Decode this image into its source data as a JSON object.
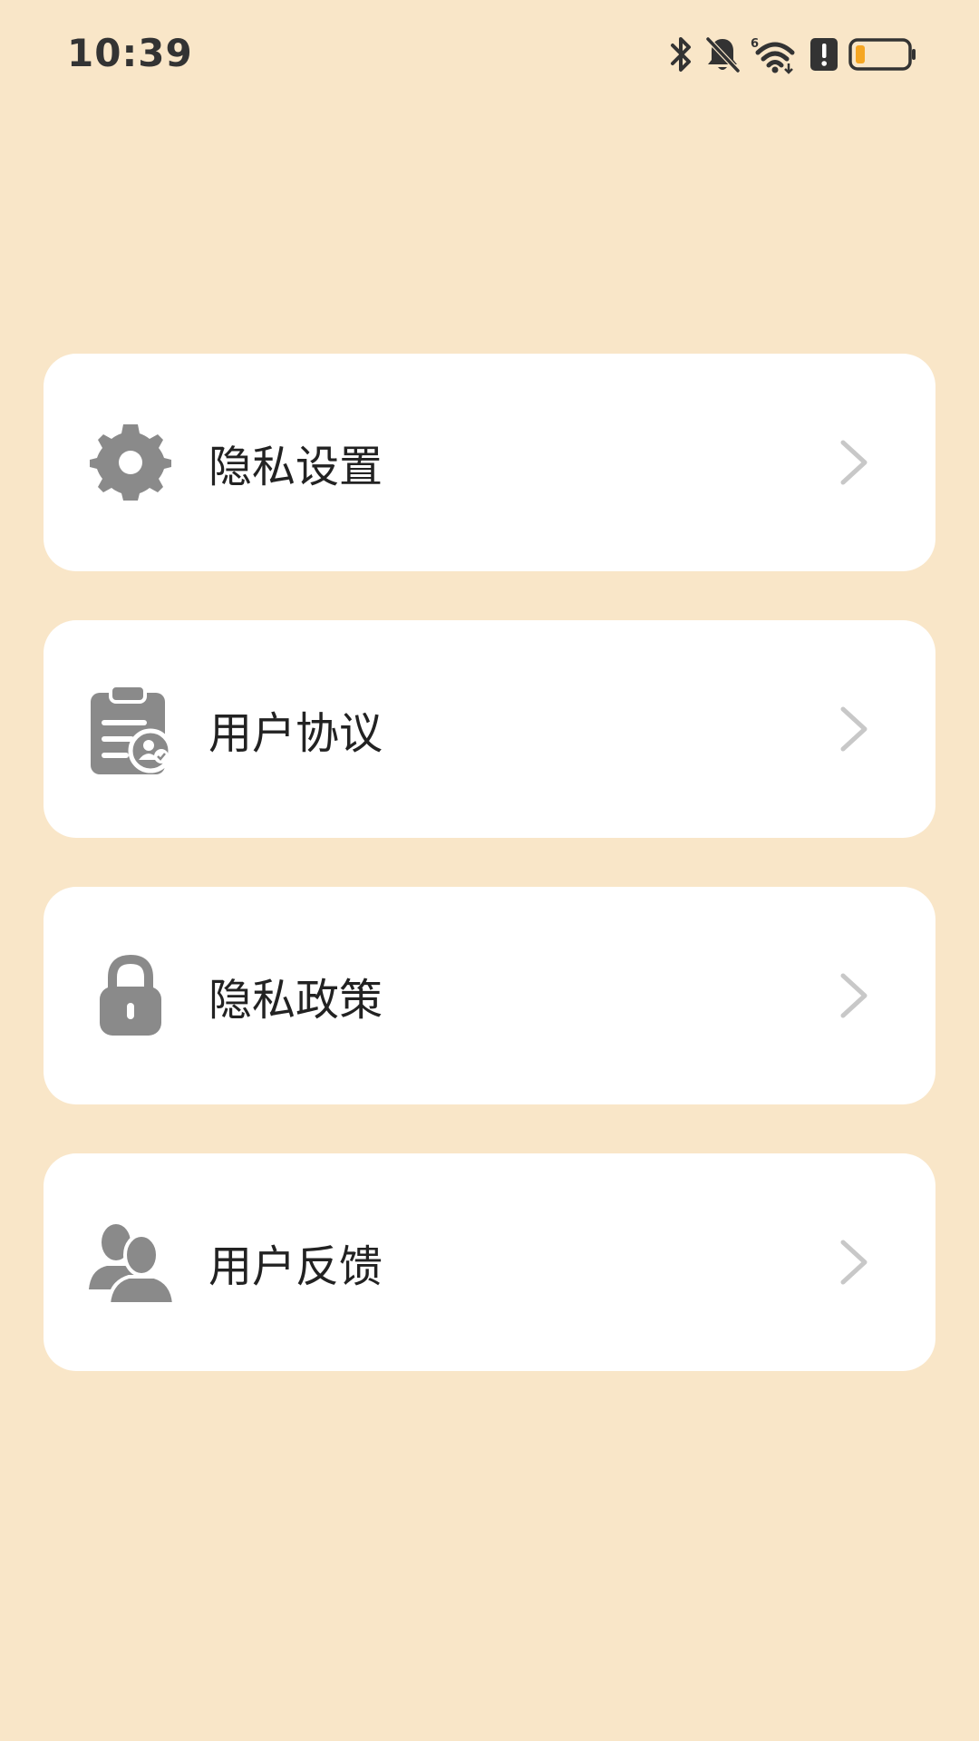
{
  "status_bar": {
    "time": "10:39",
    "icons": [
      "bluetooth-icon",
      "silent-bell-icon",
      "wifi-6-icon",
      "alert-sim-icon",
      "battery-low-icon"
    ],
    "battery_color": "#f5a623"
  },
  "menu": {
    "items": [
      {
        "label": "隐私设置",
        "icon": "gear-icon"
      },
      {
        "label": "用户协议",
        "icon": "clipboard-user-icon"
      },
      {
        "label": "隐私政策",
        "icon": "lock-icon"
      },
      {
        "label": "用户反馈",
        "icon": "users-icon"
      }
    ]
  },
  "colors": {
    "background": "#f9e6c8",
    "card": "#ffffff",
    "icon": "#8a8a8a",
    "chevron": "#c8c8c8",
    "text": "#222222"
  }
}
